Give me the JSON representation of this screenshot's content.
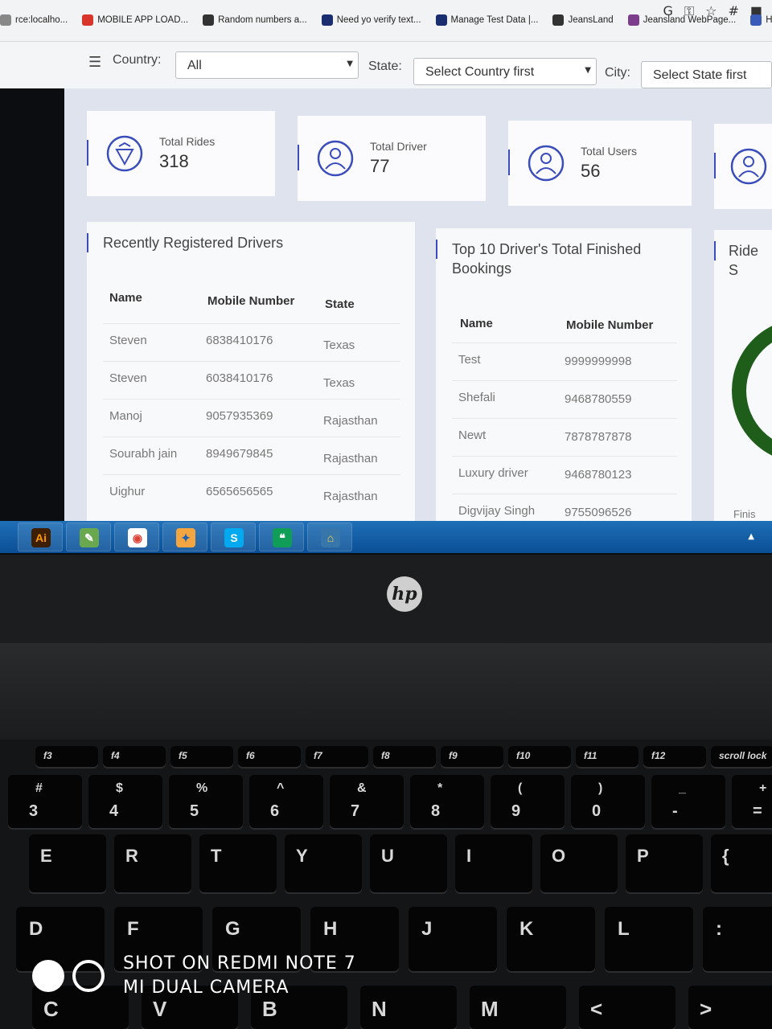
{
  "bookmarks": [
    {
      "label": "rce:localho...",
      "color": "#888888"
    },
    {
      "label": "MOBILE APP LOAD...",
      "color": "#d9362b"
    },
    {
      "label": "Random numbers a...",
      "color": "#333333"
    },
    {
      "label": "Need yo verify text...",
      "color": "#1a2d6e"
    },
    {
      "label": "Manage Test Data |...",
      "color": "#1a2d6e"
    },
    {
      "label": "JeansLand",
      "color": "#333333"
    },
    {
      "label": "Jeansland WebPage...",
      "color": "#7b3d8c"
    },
    {
      "label": "Home",
      "color": "#3a5bb8"
    }
  ],
  "filters": {
    "country_label": "Country:",
    "country_value": "All",
    "state_label": "State:",
    "state_value": "Select Country first",
    "city_label": "City:",
    "city_value": "Select State first"
  },
  "stats": [
    {
      "label": "Total Rides",
      "value": "318",
      "icon": "rides-icon"
    },
    {
      "label": "Total Driver",
      "value": "77",
      "icon": "driver-icon"
    },
    {
      "label": "Total Users",
      "value": "56",
      "icon": "users-icon"
    },
    {
      "label": "",
      "value": "",
      "icon": "user-icon"
    }
  ],
  "recent_drivers": {
    "title": "Recently Registered Drivers",
    "columns": [
      "Name",
      "Mobile Number",
      "State"
    ],
    "rows": [
      {
        "name": "Steven",
        "mobile": "6838410176",
        "state": "Texas"
      },
      {
        "name": "Steven",
        "mobile": "6038410176",
        "state": "Texas"
      },
      {
        "name": "Manoj",
        "mobile": "9057935369",
        "state": "Rajasthan"
      },
      {
        "name": "Sourabh jain",
        "mobile": "8949679845",
        "state": "Rajasthan"
      },
      {
        "name": "Uighur",
        "mobile": "6565656565",
        "state": "Rajasthan"
      }
    ]
  },
  "top_drivers": {
    "title_line1": "Top 10 Driver's Total Finished",
    "title_line2": "Bookings",
    "columns": [
      "Name",
      "Mobile Number"
    ],
    "rows": [
      {
        "name": "Test",
        "mobile": "9999999998"
      },
      {
        "name": "Shefali",
        "mobile": "9468780559"
      },
      {
        "name": "Newt",
        "mobile": "7878787878"
      },
      {
        "name": "Luxury driver",
        "mobile": "9468780123"
      },
      {
        "name": "Digvijay Singh",
        "mobile": "9755096526"
      }
    ]
  },
  "ride_panel": {
    "title": "Ride S",
    "footer": "Finis"
  },
  "taskbar_apps": [
    {
      "name": "illustrator-icon",
      "glyph": "Ai",
      "color": "#3d1e00",
      "fg": "#ff9a00"
    },
    {
      "name": "notepad-icon",
      "glyph": "✎",
      "color": "#6aa84f",
      "fg": "#ffffff"
    },
    {
      "name": "chrome-icon",
      "glyph": "◉",
      "color": "#ffffff",
      "fg": "#db4437"
    },
    {
      "name": "network-icon",
      "glyph": "✦",
      "color": "#f2a541",
      "fg": "#1a5fb4"
    },
    {
      "name": "skype-icon",
      "glyph": "S",
      "color": "#00a9f0",
      "fg": "#ffffff"
    },
    {
      "name": "hangouts-icon",
      "glyph": "❝",
      "color": "#0f9d58",
      "fg": "#ffffff"
    },
    {
      "name": "python-icon",
      "glyph": "⌂",
      "color": "#3776ab",
      "fg": "#ffd43b"
    }
  ],
  "laptop": {
    "brand": "hp"
  },
  "keyboard": {
    "fn_row": [
      "f3",
      "f4",
      "f5",
      "f6",
      "f7",
      "f8",
      "f9",
      "f10",
      "f11",
      "f12",
      "scroll lock"
    ],
    "num_row": [
      {
        "top": "#",
        "bottom": "3"
      },
      {
        "top": "$",
        "bottom": "4"
      },
      {
        "top": "%",
        "bottom": "5"
      },
      {
        "top": "^",
        "bottom": "6"
      },
      {
        "top": "&",
        "bottom": "7"
      },
      {
        "top": "*",
        "bottom": "8"
      },
      {
        "top": "(",
        "bottom": "9"
      },
      {
        "top": ")",
        "bottom": "0"
      },
      {
        "top": "_",
        "bottom": "-"
      },
      {
        "top": "+",
        "bottom": "="
      }
    ],
    "row_e": [
      "E",
      "R",
      "T",
      "Y",
      "U",
      "I",
      "O",
      "P",
      "{"
    ],
    "row_d": [
      "D",
      "F",
      "G",
      "H",
      "J",
      "K",
      "L",
      ":"
    ],
    "row_c": [
      "C",
      "V",
      "B",
      "N",
      "M",
      "<",
      ">"
    ]
  },
  "watermark": {
    "line1": "SHOT ON REDMI NOTE 7",
    "line2": "MI DUAL CAMERA"
  }
}
